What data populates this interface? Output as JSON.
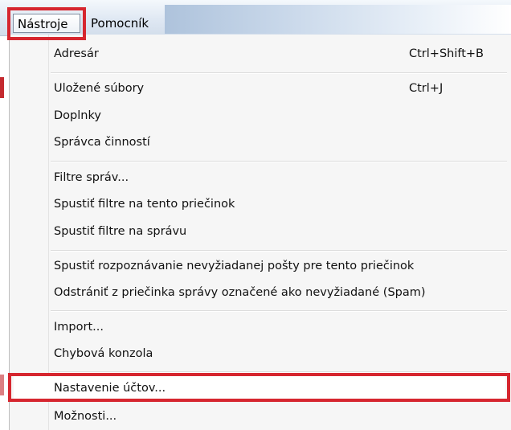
{
  "menubar": {
    "menus": [
      {
        "label": "Nástroje"
      },
      {
        "label": "Pomocník"
      }
    ]
  },
  "dropdown": {
    "items": [
      {
        "label": "Adresár",
        "shortcut": "Ctrl+Shift+B"
      },
      {
        "label": "Uložené súbory",
        "shortcut": "Ctrl+J"
      },
      {
        "label": "Doplnky"
      },
      {
        "label": "Správca činností"
      },
      {
        "label": "Filtre správ..."
      },
      {
        "label": "Spustiť filtre na tento priečinok"
      },
      {
        "label": "Spustiť filtre na správu"
      },
      {
        "label": "Spustiť rozpoznávanie nevyžiadanej pošty pre tento priečinok"
      },
      {
        "label": "Odstrániť z priečinka správy označené ako nevyžiadané (Spam)"
      },
      {
        "label": "Import..."
      },
      {
        "label": "Chybová konzola"
      },
      {
        "label": "Nastavenie účtov..."
      },
      {
        "label": "Možnosti..."
      }
    ]
  },
  "colors": {
    "highlight_outline": "#d6262f",
    "menubar_gradient_top": "#f4f8fc",
    "dropdown_bg": "#f6f6f6"
  }
}
